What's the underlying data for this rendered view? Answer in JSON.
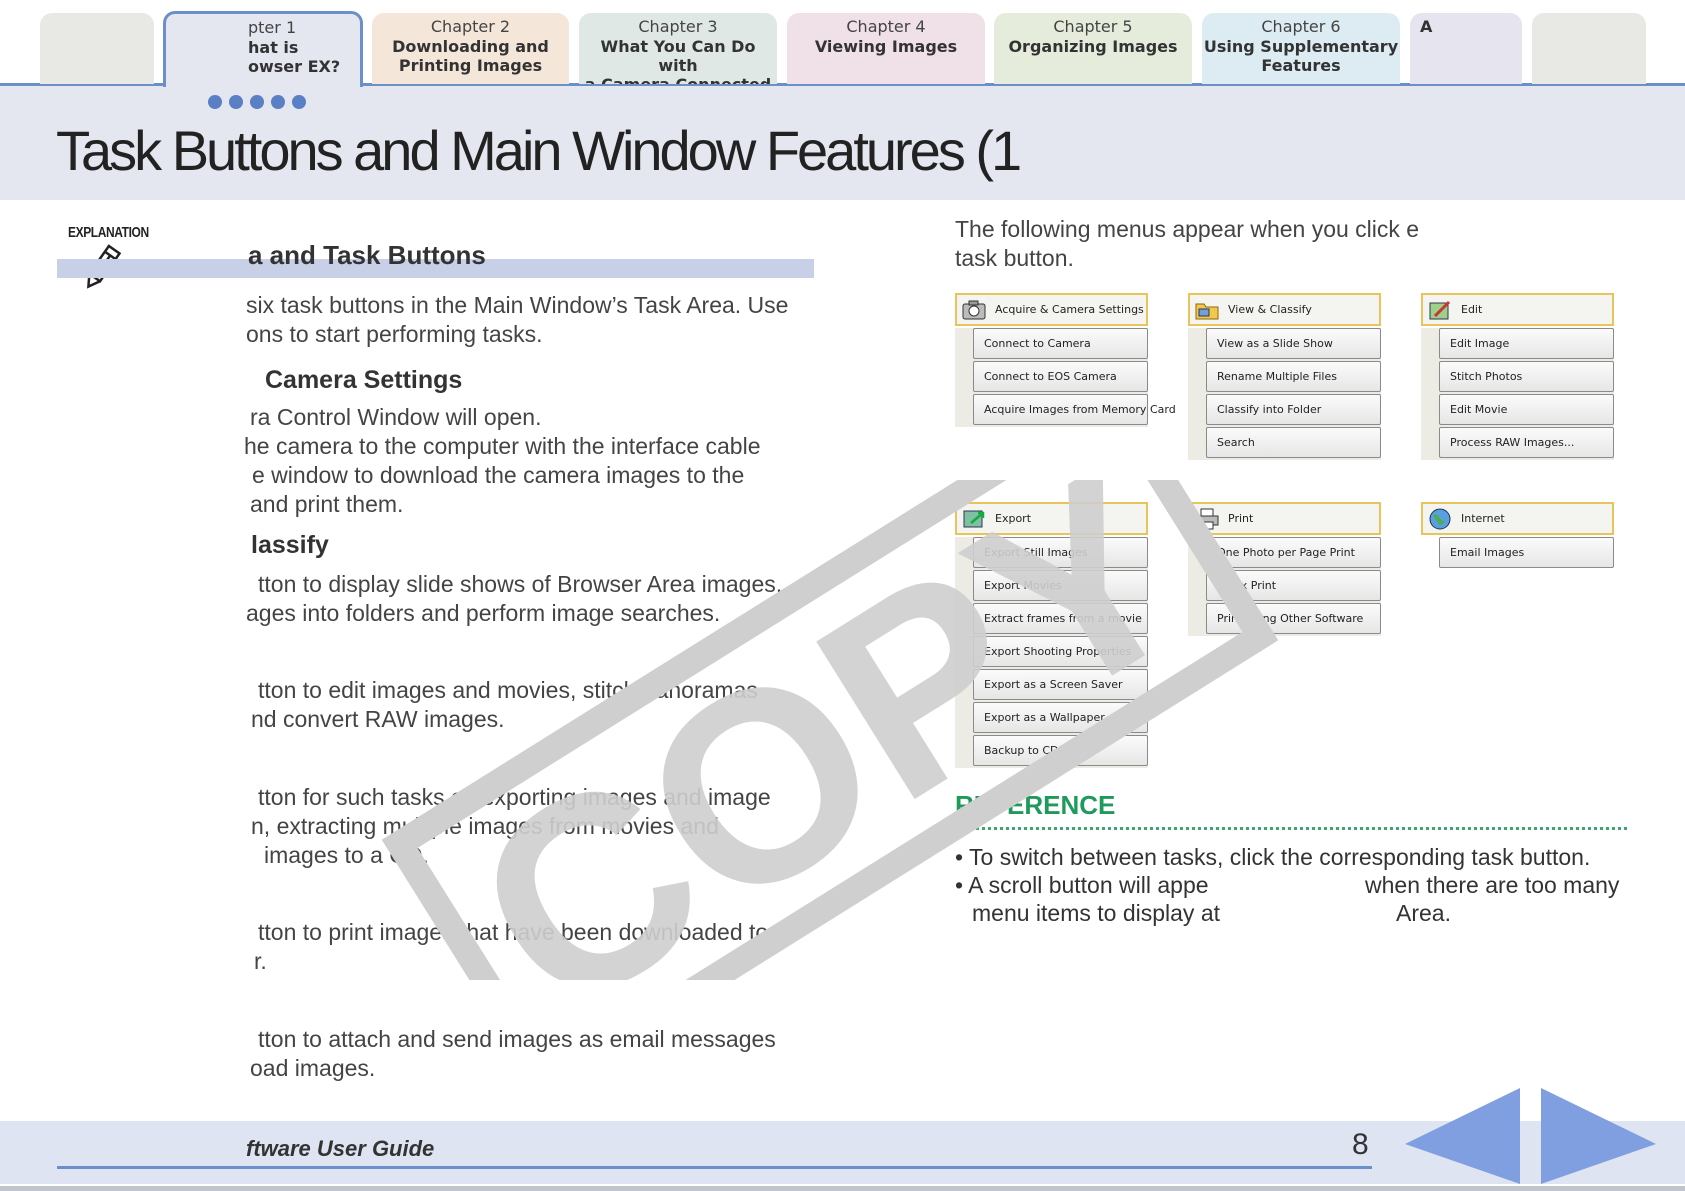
{
  "tabs": [
    {
      "num": "pter 1",
      "title": "hat is\nowser EX?"
    },
    {
      "num": "Chapter 2",
      "title": "Downloading and\nPrinting Images"
    },
    {
      "num": "Chapter 3",
      "title": "What You Can Do with\na Camera Connected"
    },
    {
      "num": "Chapter 4",
      "title": "Viewing Images"
    },
    {
      "num": "Chapter 5",
      "title": "Organizing Images"
    },
    {
      "num": "Chapter 6",
      "title": "Using Supplementary\nFeatures"
    },
    {
      "num": "",
      "title": "A"
    }
  ],
  "page_title": "Task Buttons and Main Window Features (1",
  "explanation_label": "EXPLANATION",
  "section_heading": "a and Task Buttons",
  "intro_lines": [
    "six task buttons in the Main Window’s Task Area. Use",
    "ons to start performing tasks."
  ],
  "blocks": [
    {
      "heading": "Camera Settings",
      "lines": [
        "ra Control Window will open.",
        "he camera to the computer with the interface cable",
        "e window to download the camera images to the",
        "and print them."
      ]
    },
    {
      "heading": "lassify",
      "lines": [
        "tton to display slide shows of Browser Area images,",
        "ages into folders and perform image searches."
      ]
    },
    {
      "heading": "",
      "lines": [
        "tton to edit images and movies, stitch panoramas",
        "nd convert RAW images."
      ]
    },
    {
      "heading": "",
      "lines": [
        "tton for such tasks as exporting images and image",
        "n, extracting multiple images from movies and",
        "images to a CD."
      ]
    },
    {
      "heading": "",
      "lines": [
        "tton to print images that have been downloaded to",
        "r."
      ]
    },
    {
      "heading": "",
      "lines": [
        "tton to attach and send images as email messages",
        "oad images."
      ]
    }
  ],
  "menus_intro": [
    "The following menus appear when you click e",
    "task button."
  ],
  "menus": [
    {
      "title": "Acquire & Camera Settings",
      "icon": "camera-icon",
      "items": [
        "Connect to Camera",
        "Connect to EOS Camera",
        "Acquire Images from Memory Card"
      ]
    },
    {
      "title": "View & Classify",
      "icon": "folder-icon",
      "items": [
        "View as a Slide Show",
        "Rename Multiple Files",
        "Classify into Folder",
        "Search"
      ]
    },
    {
      "title": "Edit",
      "icon": "edit-icon",
      "items": [
        "Edit Image",
        "Stitch Photos",
        "Edit Movie",
        "Process RAW Images..."
      ]
    },
    {
      "title": "Export",
      "icon": "export-icon",
      "items": [
        "Export Still Images",
        "Export Movies",
        "Extract frames from a movie",
        "Export Shooting Properties",
        "Export as a Screen Saver",
        "Export as a Wallpaper",
        "Backup to CD"
      ]
    },
    {
      "title": "Print",
      "icon": "printer-icon",
      "items": [
        "One Photo per Page Print",
        "Index Print",
        "Print Using Other Software"
      ]
    },
    {
      "title": "Internet",
      "icon": "globe-icon",
      "items": [
        "Email Images"
      ]
    }
  ],
  "reference": {
    "title": "REFERENCE",
    "items": [
      [
        "• To switch between tasks, click the corresponding task button."
      ],
      [
        "• A scroll button will appe",
        "when there are too many"
      ],
      [
        "menu items to display at",
        "Area."
      ]
    ]
  },
  "watermark": "COPY",
  "footer": {
    "title": "ftware User Guide",
    "page_number": "8"
  },
  "colors": {
    "accent": "#6b8fc8",
    "reference": "#1f9a5a",
    "nav_arrow": "#7f9fe0"
  }
}
